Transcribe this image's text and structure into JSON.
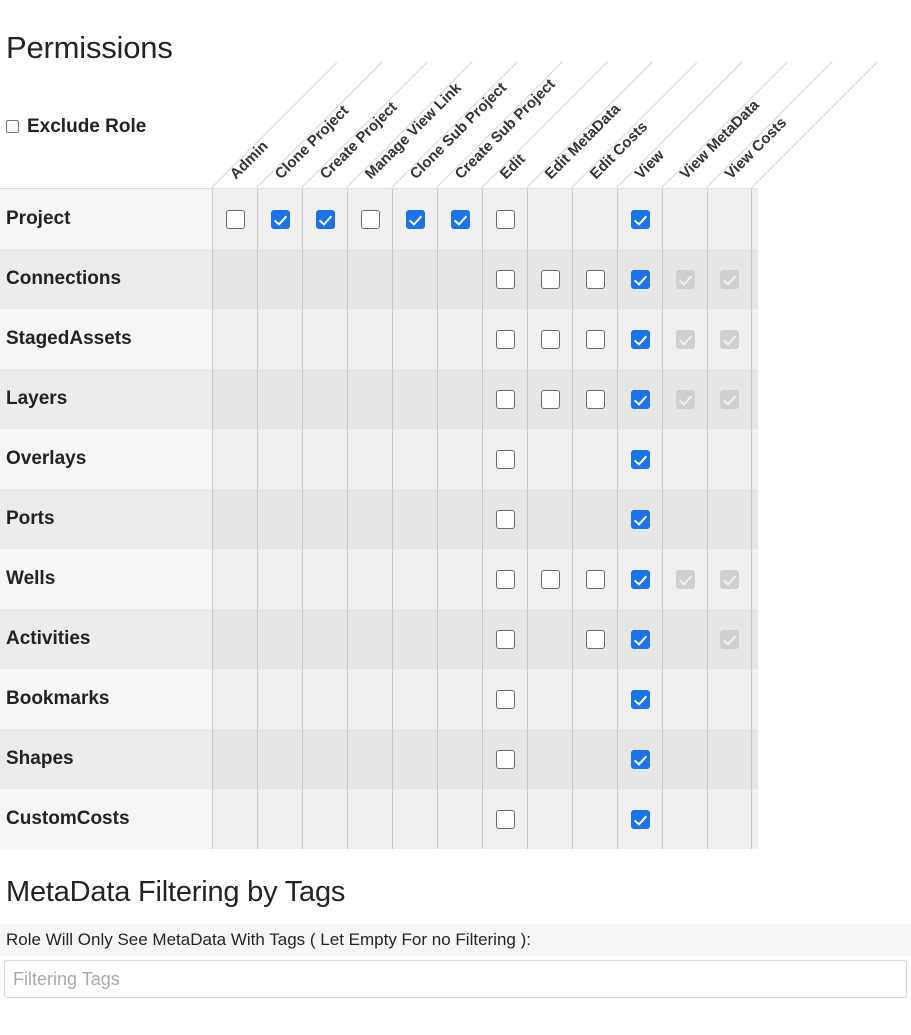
{
  "page_title": "Permissions",
  "exclude_role": {
    "label": "Exclude Role",
    "checked": false
  },
  "colors": {
    "checked_blue": "#1a73e8",
    "disabled_gray": "#cfcfcf",
    "row_odd": "#f6f6f6",
    "row_even": "#ececec"
  },
  "matrix": {
    "columns": [
      "Admin",
      "Clone Project",
      "Create Project",
      "Manage View Link",
      "Clone Sub Project",
      "Create Sub Project",
      "Edit",
      "Edit MetaData",
      "Edit Costs",
      "View",
      "View MetaData",
      "View Costs"
    ],
    "rows": [
      {
        "label": "Project",
        "cells": [
          "off",
          "on",
          "on",
          "off",
          "on",
          "on",
          "off",
          "none",
          "none",
          "on",
          "none",
          "none"
        ]
      },
      {
        "label": "Connections",
        "cells": [
          "none",
          "none",
          "none",
          "none",
          "none",
          "none",
          "off",
          "off",
          "off",
          "on",
          "dis",
          "dis"
        ]
      },
      {
        "label": "StagedAssets",
        "cells": [
          "none",
          "none",
          "none",
          "none",
          "none",
          "none",
          "off",
          "off",
          "off",
          "on",
          "dis",
          "dis"
        ]
      },
      {
        "label": "Layers",
        "cells": [
          "none",
          "none",
          "none",
          "none",
          "none",
          "none",
          "off",
          "off",
          "off",
          "on",
          "dis",
          "dis"
        ]
      },
      {
        "label": "Overlays",
        "cells": [
          "none",
          "none",
          "none",
          "none",
          "none",
          "none",
          "off",
          "none",
          "none",
          "on",
          "none",
          "none"
        ]
      },
      {
        "label": "Ports",
        "cells": [
          "none",
          "none",
          "none",
          "none",
          "none",
          "none",
          "off",
          "none",
          "none",
          "on",
          "none",
          "none"
        ]
      },
      {
        "label": "Wells",
        "cells": [
          "none",
          "none",
          "none",
          "none",
          "none",
          "none",
          "off",
          "off",
          "off",
          "on",
          "dis",
          "dis"
        ]
      },
      {
        "label": "Activities",
        "cells": [
          "none",
          "none",
          "none",
          "none",
          "none",
          "none",
          "off",
          "none",
          "off",
          "on",
          "none",
          "dis"
        ]
      },
      {
        "label": "Bookmarks",
        "cells": [
          "none",
          "none",
          "none",
          "none",
          "none",
          "none",
          "off",
          "none",
          "none",
          "on",
          "none",
          "none"
        ]
      },
      {
        "label": "Shapes",
        "cells": [
          "none",
          "none",
          "none",
          "none",
          "none",
          "none",
          "off",
          "none",
          "none",
          "on",
          "none",
          "none"
        ]
      },
      {
        "label": "CustomCosts",
        "cells": [
          "none",
          "none",
          "none",
          "none",
          "none",
          "none",
          "off",
          "none",
          "none",
          "on",
          "none",
          "none"
        ]
      }
    ]
  },
  "metadata_filtering": {
    "title": "MetaData Filtering by Tags",
    "description": "Role Will Only See MetaData With Tags ( Let Empty For no Filtering ):",
    "input_placeholder": "Filtering Tags",
    "input_value": ""
  }
}
